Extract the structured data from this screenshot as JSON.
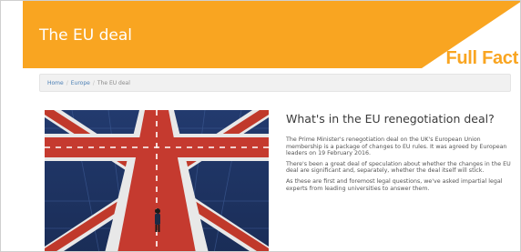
{
  "header": {
    "title": "The EU deal",
    "logo_text": "Full Fact",
    "background": "#f9a521"
  },
  "breadcrumb": {
    "items": [
      "Home",
      "Europe",
      "The EU deal"
    ],
    "separator": "/"
  },
  "hero": {
    "icon": "union-jack-road-image"
  },
  "article": {
    "title": "What's in the EU renegotiation deal?",
    "paragraphs": [
      "The Prime Minister's renegotiation deal on the UK's European Union membership is a package of changes to EU rules. It was agreed by European leaders on 19 February 2016.",
      "There's been a great deal of speculation about whether the changes in the EU deal are significant and, separately, whether the deal itself will stick.",
      "As these are first and foremost legal questions, we've asked impartial legal experts from leading universities to answer them."
    ]
  }
}
